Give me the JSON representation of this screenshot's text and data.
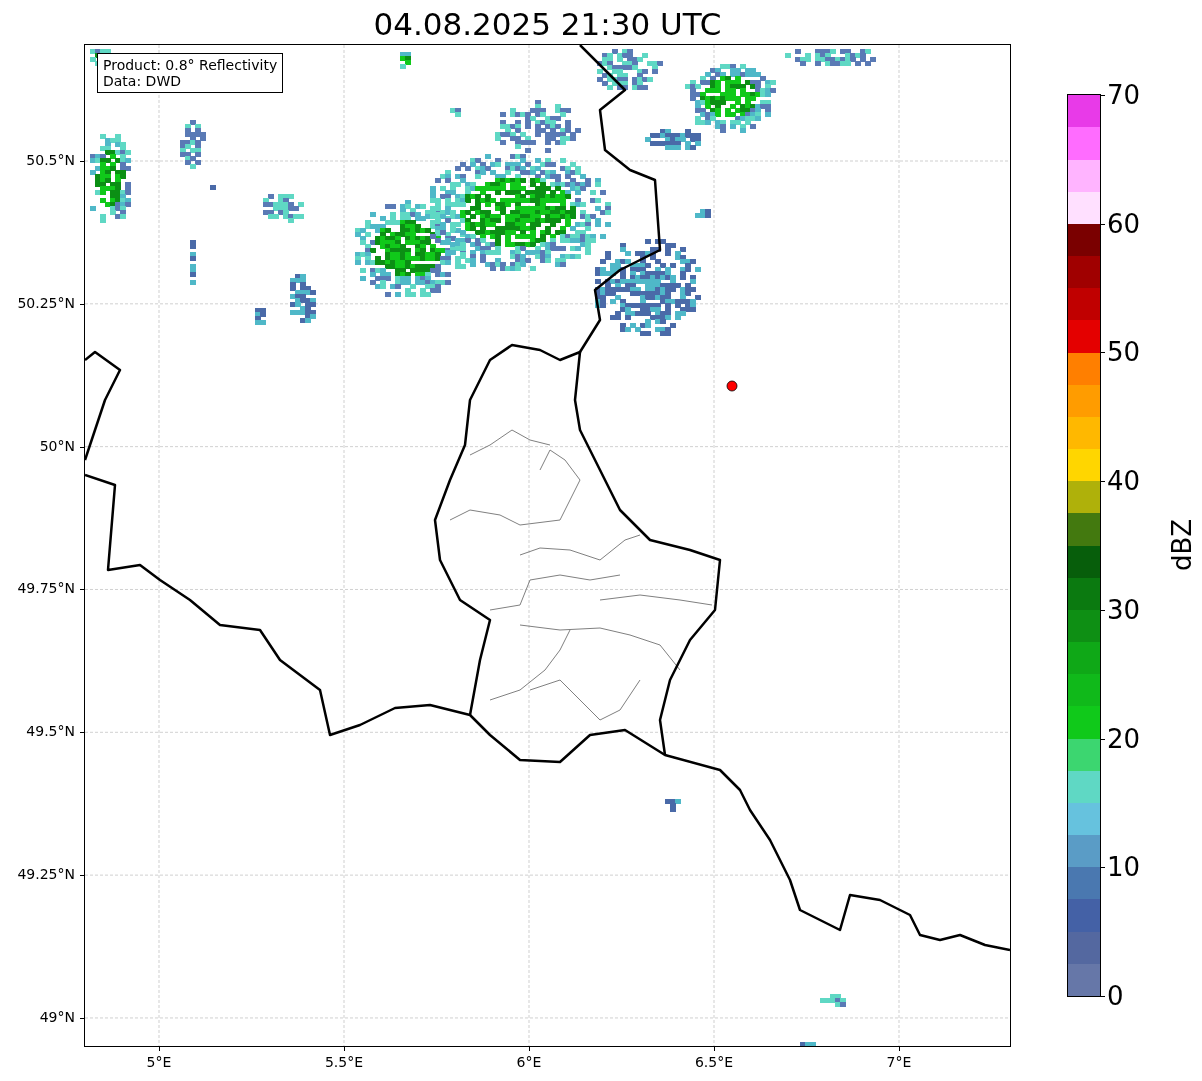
{
  "title": "04.08.2025 21:30 UTC",
  "info_box": {
    "lines": [
      "Product: 0.8° Reflectivity",
      "Data: DWD"
    ]
  },
  "map": {
    "lat_ticks": [
      "50.5°N",
      "50.25°N",
      "50°N",
      "49.75°N",
      "49.5°N",
      "49.25°N",
      "49°N"
    ],
    "lon_ticks": [
      "5°E",
      "5.5°E",
      "6°E",
      "6.5°E",
      "7°E"
    ]
  },
  "colorbar": {
    "label": "dBZ",
    "ticks": [
      "70",
      "60",
      "50",
      "40",
      "30",
      "20",
      "10",
      "0"
    ],
    "segments": [
      {
        "color": "#6677a8"
      },
      {
        "color": "#5468a0"
      },
      {
        "color": "#4461a6"
      },
      {
        "color": "#4a78b0"
      },
      {
        "color": "#5a9cc6"
      },
      {
        "color": "#66c2de"
      },
      {
        "color": "#5fd8c4"
      },
      {
        "color": "#3cd670"
      },
      {
        "color": "#10c91a"
      },
      {
        "color": "#10b91a"
      },
      {
        "color": "#0fa817"
      },
      {
        "color": "#0e8f14"
      },
      {
        "color": "#0b7a10"
      },
      {
        "color": "#075e0b"
      },
      {
        "color": "#43790f"
      },
      {
        "color": "#afb10a"
      },
      {
        "color": "#ffd600"
      },
      {
        "color": "#ffb800"
      },
      {
        "color": "#ff9c00"
      },
      {
        "color": "#ff7f00"
      },
      {
        "color": "#e40000"
      },
      {
        "color": "#c00000"
      },
      {
        "color": "#a00000"
      },
      {
        "color": "#7a0000"
      },
      {
        "color": "#ffe0ff"
      },
      {
        "color": "#ffb4ff"
      },
      {
        "color": "#ff6cff"
      },
      {
        "color": "#e83ae8"
      }
    ]
  }
}
